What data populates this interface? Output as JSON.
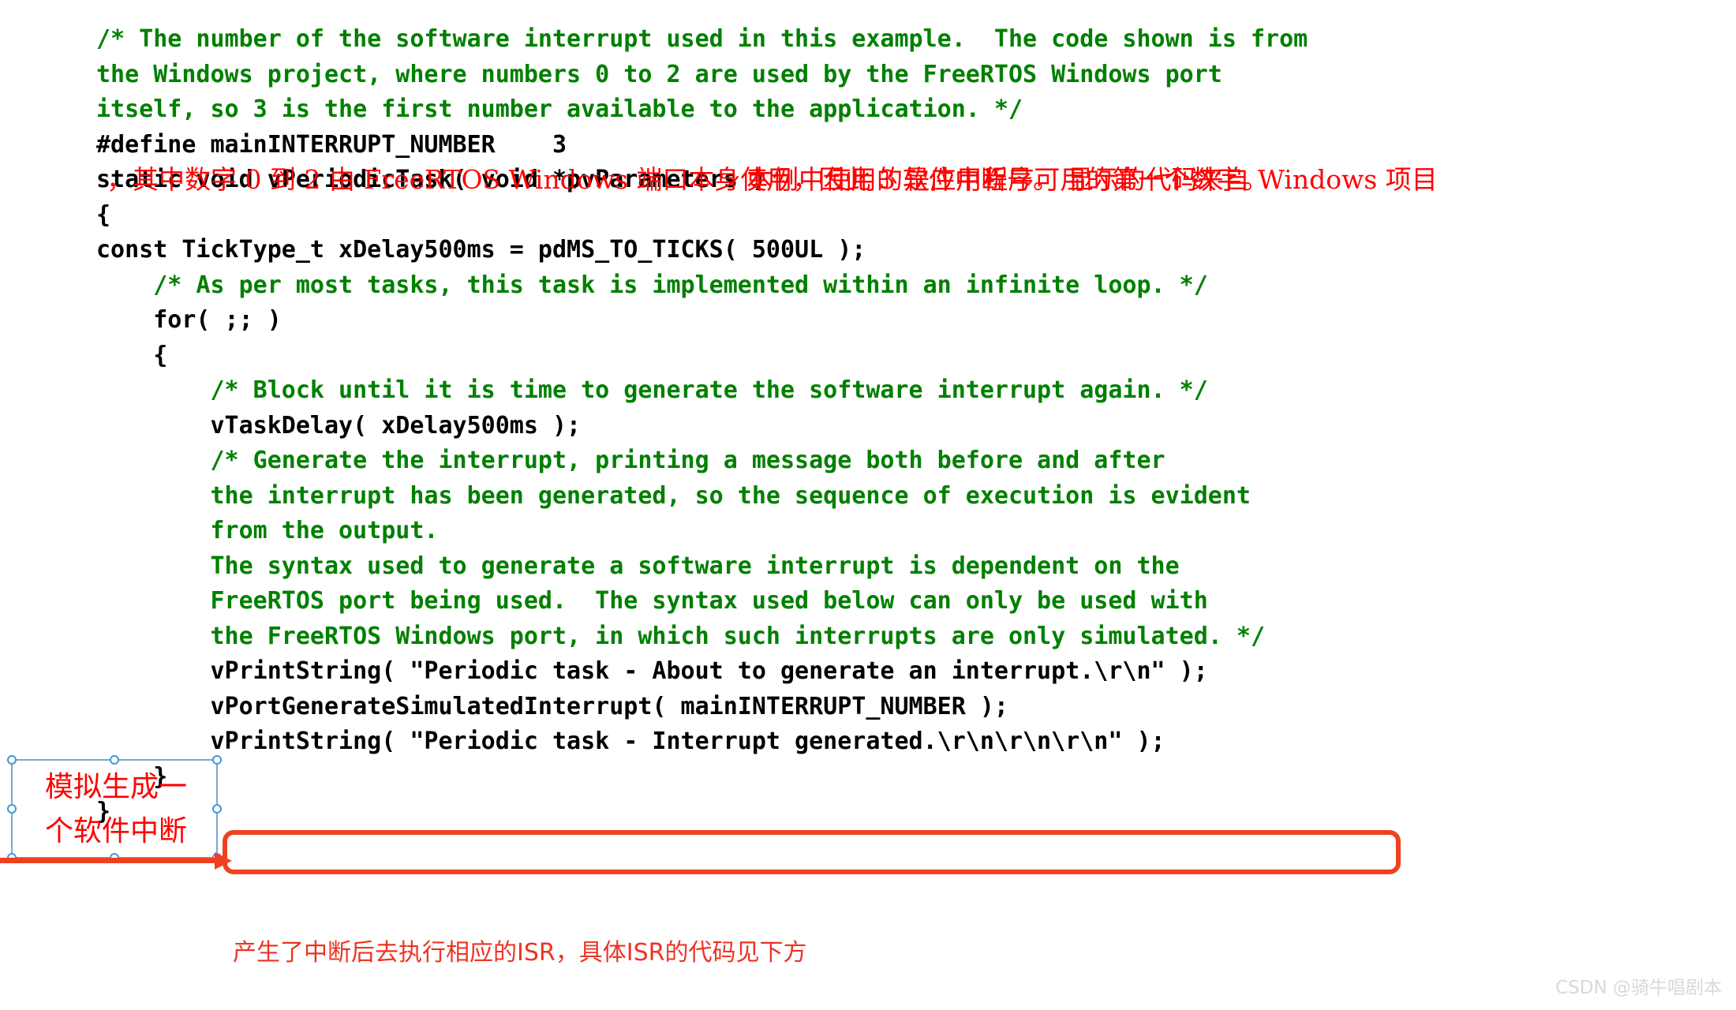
{
  "document": {
    "type": "code-listing-screenshot",
    "language": "C",
    "colors": {
      "comment_green": "#008000",
      "code_black": "#000000",
      "annotation_red": "#ff0000",
      "highlight_orange": "#f04020",
      "selection_blue": "#7ba7cc",
      "watermark_gray": "#d9d9d9",
      "background": "#ffffff"
    }
  },
  "code": {
    "lines": [
      {
        "text": "/* The number of the software interrupt used in this example.  The code shown is from",
        "style": "comment"
      },
      {
        "text": "the Windows project, where numbers 0 to 2 are used by the FreeRTOS Windows port",
        "style": "comment"
      },
      {
        "text": "itself, so 3 is the first number available to the application. */",
        "style": "comment"
      },
      {
        "text": "#define mainINTERRUPT_NUMBER    3",
        "style": "code"
      },
      {
        "text": "",
        "style": "blank"
      },
      {
        "text": "static void vPeriodicTask( void *pvParameters )",
        "style": "code"
      },
      {
        "text": "{",
        "style": "code"
      },
      {
        "text": "const TickType_t xDelay500ms = pdMS_TO_TICKS( 500UL );",
        "style": "code"
      },
      {
        "text": "",
        "style": "blank"
      },
      {
        "text": "    /* As per most tasks, this task is implemented within an infinite loop. */",
        "style": "comment"
      },
      {
        "text": "    for( ;; )",
        "style": "code"
      },
      {
        "text": "    {",
        "style": "code"
      },
      {
        "text": "        /* Block until it is time to generate the software interrupt again. */",
        "style": "comment"
      },
      {
        "text": "        vTaskDelay( xDelay500ms );",
        "style": "code"
      },
      {
        "text": "",
        "style": "blank"
      },
      {
        "text": "        /* Generate the interrupt, printing a message both before and after",
        "style": "comment"
      },
      {
        "text": "        the interrupt has been generated, so the sequence of execution is evident",
        "style": "comment"
      },
      {
        "text": "        from the output.",
        "style": "comment"
      },
      {
        "text": "",
        "style": "blank"
      },
      {
        "text": "        The syntax used to generate a software interrupt is dependent on the",
        "style": "comment"
      },
      {
        "text": "        FreeRTOS port being used.  The syntax used below can only be used with",
        "style": "comment"
      },
      {
        "text": "        the FreeRTOS Windows port, in which such interrupts are only simulated. */",
        "style": "comment"
      },
      {
        "text": "        vPrintString( \"Periodic task - About to generate an interrupt.\\r\\n\" );",
        "style": "code"
      },
      {
        "text": "        vPortGenerateSimulatedInterrupt( mainINTERRUPT_NUMBER );",
        "style": "code"
      },
      {
        "text": "        vPrintString( \"Periodic task - Interrupt generated.\\r\\n\\r\\n\\r\\n\" );",
        "style": "code"
      },
      {
        "text": "    }",
        "style": "code"
      },
      {
        "text": "}",
        "style": "code"
      }
    ]
  },
  "annotations": {
    "define_note": {
      "line1": "本例中使用的软件中断号。 显示的代码来自 Windows 项目",
      "line2": "，其中数字 0 到 2 由 FreeRTOS Windows 端口本身使用，因此 3 是应用程序可用的第一个数字。"
    },
    "callout": {
      "text": "模拟生成一\n个软件中断"
    },
    "isr_note": {
      "text": "产生了中断后去执行相应的ISR，具体ISR的代码见下方"
    }
  },
  "watermark": {
    "text": "CSDN @骑牛唱剧本"
  }
}
